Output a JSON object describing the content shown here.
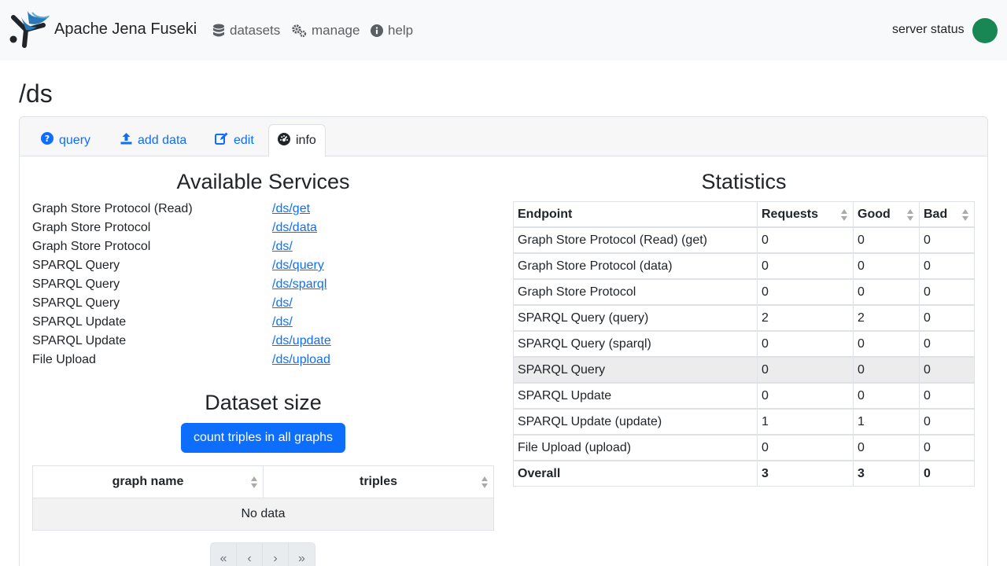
{
  "navbar": {
    "brand": "Apache Jena Fuseki",
    "items": [
      {
        "label": "datasets",
        "icon": "database-icon"
      },
      {
        "label": "manage",
        "icon": "gears-icon"
      },
      {
        "label": "help",
        "icon": "info-circle-icon"
      }
    ],
    "server_status_label": "server status",
    "server_status_color": "#198754"
  },
  "page_title": "/ds",
  "tabs": [
    {
      "label": "query",
      "icon": "question-circle-icon"
    },
    {
      "label": "add data",
      "icon": "upload-icon"
    },
    {
      "label": "edit",
      "icon": "edit-icon"
    },
    {
      "label": "info",
      "icon": "dashboard-icon",
      "active": true
    }
  ],
  "services": {
    "title": "Available Services",
    "rows": [
      {
        "name": "Graph Store Protocol (Read)",
        "link": "/ds/get"
      },
      {
        "name": "Graph Store Protocol",
        "link": "/ds/data"
      },
      {
        "name": "Graph Store Protocol",
        "link": "/ds/"
      },
      {
        "name": "SPARQL Query",
        "link": "/ds/query"
      },
      {
        "name": "SPARQL Query",
        "link": "/ds/sparql"
      },
      {
        "name": "SPARQL Query",
        "link": "/ds/"
      },
      {
        "name": "SPARQL Update",
        "link": "/ds/"
      },
      {
        "name": "SPARQL Update",
        "link": "/ds/update"
      },
      {
        "name": "File Upload",
        "link": "/ds/upload"
      }
    ]
  },
  "dataset_size": {
    "title": "Dataset size",
    "button": "count triples in all graphs",
    "columns": [
      "graph name",
      "triples"
    ],
    "empty_text": "No data",
    "pager": [
      "«",
      "‹",
      "›",
      "»"
    ]
  },
  "statistics": {
    "title": "Statistics",
    "columns": [
      "Endpoint",
      "Requests",
      "Good",
      "Bad"
    ],
    "rows": [
      [
        "Graph Store Protocol (Read) (get)",
        "0",
        "0",
        "0"
      ],
      [
        "Graph Store Protocol (data)",
        "0",
        "0",
        "0"
      ],
      [
        "Graph Store Protocol",
        "0",
        "0",
        "0"
      ],
      [
        "SPARQL Query (query)",
        "2",
        "2",
        "0"
      ],
      [
        "SPARQL Query (sparql)",
        "0",
        "0",
        "0"
      ],
      [
        "SPARQL Query",
        "0",
        "0",
        "0"
      ],
      [
        "SPARQL Update",
        "0",
        "0",
        "0"
      ],
      [
        "SPARQL Update (update)",
        "1",
        "1",
        "0"
      ],
      [
        "File Upload (upload)",
        "0",
        "0",
        "0"
      ],
      [
        "Overall",
        "3",
        "3",
        "0"
      ]
    ]
  }
}
